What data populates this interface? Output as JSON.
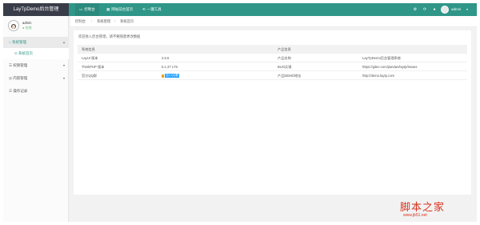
{
  "header": {
    "logo": "LayTpDemo后台管理",
    "nav": [
      {
        "icon": "▭",
        "label": "控制台",
        "active": true
      },
      {
        "icon": "▦",
        "label": "网站前台首页"
      },
      {
        "icon": "⟲",
        "label": "一键工具"
      }
    ],
    "user": "admin",
    "caret": "▾",
    "icons": [
      "⚙",
      "⟳",
      "●"
    ]
  },
  "sidebar": {
    "user_name": "admin",
    "user_status": "● 在线",
    "items": [
      {
        "icon": "⌂",
        "label": "系统管理",
        "caret": "▴"
      },
      {
        "icon": "⊙",
        "label": "系统首页"
      },
      {
        "icon": "☰",
        "label": "权限管理",
        "caret": "▾"
      },
      {
        "icon": "◎",
        "label": "内容管理",
        "caret": "▾"
      },
      {
        "icon": "☰",
        "label": "操作记录"
      }
    ]
  },
  "breadcrumb": [
    {
      "label": "控制台"
    },
    {
      "label": "系统管理"
    },
    {
      "label": "系统首页"
    }
  ],
  "breadcrumb_sep": "/",
  "main": {
    "description": "欢迎进入后台管理，请不要随意更改数据",
    "table": {
      "headers": [
        "系统信息",
        "",
        "产品信息",
        ""
      ],
      "rows": [
        [
          "LayUI 版本",
          "2.5.5",
          "产品名称",
          "LayTpDemo后台管理系统"
        ],
        [
          "ThinkPHP 版本",
          "5.1.37 LTS",
          "BUG反馈",
          "https://gitee.com/jiandan/laytp/issues"
        ],
        [
          "官方QQ群",
          "",
          "产品DEMO地址",
          "http://demo.laytp.com"
        ]
      ],
      "qq_badge": "加入QQ群"
    }
  },
  "watermark": {
    "title": "脚本之家",
    "sub": "www.jb51.net"
  }
}
